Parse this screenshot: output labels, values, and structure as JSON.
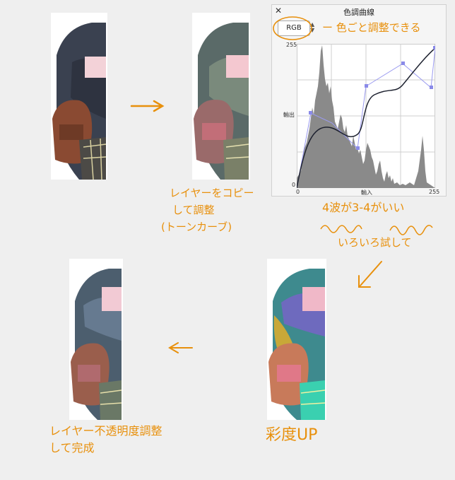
{
  "curve_panel": {
    "title": "色調曲線",
    "close_icon": "close-icon",
    "channel": "RGB",
    "axis_max_y": "255",
    "axis_min_y": "0",
    "axis_min_x": "0",
    "axis_max_x": "255",
    "ylabel": "輸出",
    "xlabel": "輸入"
  },
  "annotations": {
    "channel_note": "ー 色ごと調整できる",
    "copy_note_line1": "レイヤーをコピー",
    "copy_note_line2": "して調整",
    "copy_note_line3": "(トーンカーブ)",
    "wave_note": "4波が3-4がいい",
    "try_note": "いろいろ試して",
    "saturation_note": "彩度UP",
    "opacity_note_line1": "レイヤー不透明度調整",
    "opacity_note_line2": "して完成"
  },
  "colors": {
    "annotation": "#e8900c",
    "histogram": "#8a8a8a",
    "curve": "#1e2230",
    "handle": "#8a8ae8"
  }
}
